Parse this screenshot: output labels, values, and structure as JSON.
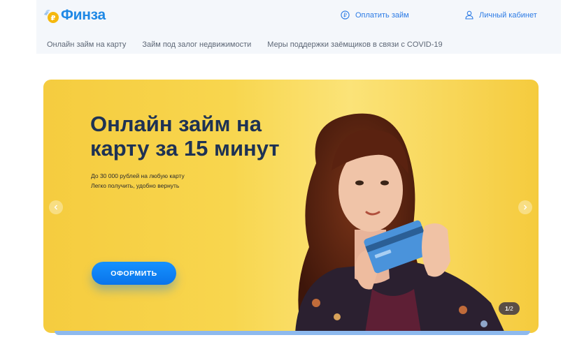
{
  "header": {
    "logo_text": "Финза",
    "pay_loan": "Оплатить займ",
    "account": "Личный кабинет"
  },
  "subnav": {
    "items": [
      "Онлайн займ на карту",
      "Займ под залог недвижимости",
      "Меры поддержки заёмщиков в связи с COVID-19"
    ]
  },
  "hero": {
    "title": "Онлайн займ на карту за 15 минут",
    "subtitle_line1": "До 30 000 рублей на любую карту",
    "subtitle_line2": "Легко получить, удобно вернуть",
    "cta_label": "ОФОРМИТЬ",
    "counter_current": "1",
    "counter_total": "/2"
  },
  "colors": {
    "brand": "#1e88e5",
    "cta": "#0a74ea",
    "hero_bg": "#f8d64e",
    "title": "#1e3254"
  }
}
